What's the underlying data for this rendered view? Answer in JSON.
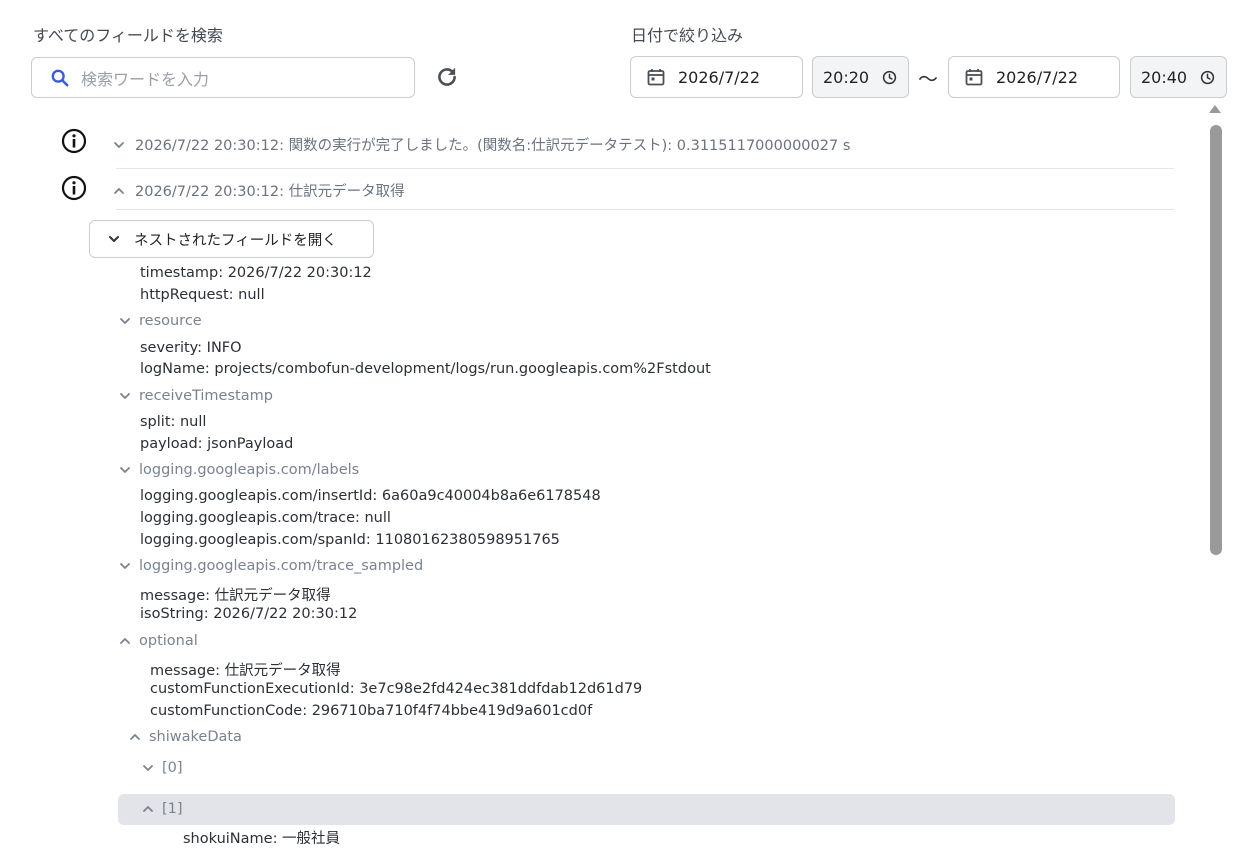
{
  "search": {
    "label": "すべてのフィールドを検索",
    "placeholder": "検索ワードを入力"
  },
  "filter": {
    "label": "日付で絞り込み",
    "start_date": "2026/7/22",
    "start_time": "20:20",
    "separator": "〜",
    "end_date": "2026/7/22",
    "end_time": "20:40"
  },
  "logs": [
    {
      "text": "2026/7/22 20:30:12: 関数の実行が完了しました。(関数名:仕訳元データテスト): 0.3115117000000027 s",
      "expanded": false
    },
    {
      "text": "2026/7/22 20:30:12: 仕訳元データ取得",
      "expanded": true
    }
  ],
  "nested_button": {
    "label": "ネストされたフィールドを開く"
  },
  "fields": {
    "timestamp": "timestamp: 2026/7/22 20:30:12",
    "httpRequest": "httpRequest: null",
    "resource": "resource",
    "severity": "severity: INFO",
    "logName": "logName: projects/combofun-development/logs/run.googleapis.com%2Fstdout",
    "receiveTimestamp": "receiveTimestamp",
    "split": "split: null",
    "payload": "payload: jsonPayload",
    "labels": "logging.googleapis.com/labels",
    "insertId": "logging.googleapis.com/insertId: 6a60a9c40004b8a6e6178548",
    "trace": "logging.googleapis.com/trace: null",
    "spanId": "logging.googleapis.com/spanId: 11080162380598951765",
    "trace_sampled": "logging.googleapis.com/trace_sampled",
    "message": "message: 仕訳元データ取得",
    "isoString": "isoString: 2026/7/22 20:30:12",
    "optional": "optional",
    "opt_message": "message: 仕訳元データ取得",
    "customFunctionExecutionId": "customFunctionExecutionId: 3e7c98e2fd424ec381ddfdab12d61d79",
    "customFunctionCode": "customFunctionCode: 296710ba710f4f74bbe419d9a601cd0f",
    "shiwakeData": "shiwakeData",
    "item0": "[0]",
    "item1": "[1]",
    "shokuiName": "shokuiName: 一般社員"
  },
  "icons": {
    "search": "search-icon",
    "refresh": "refresh-icon",
    "calendar": "calendar-icon",
    "clock": "clock-icon",
    "info": "info-icon",
    "chevron_down": "chevron-down-icon",
    "chevron_up": "chevron-up-icon"
  },
  "colors": {
    "accent": "#3b5bdb",
    "highlight_row": "#e2e4e9",
    "scrollbar": "#9a9a9a"
  }
}
